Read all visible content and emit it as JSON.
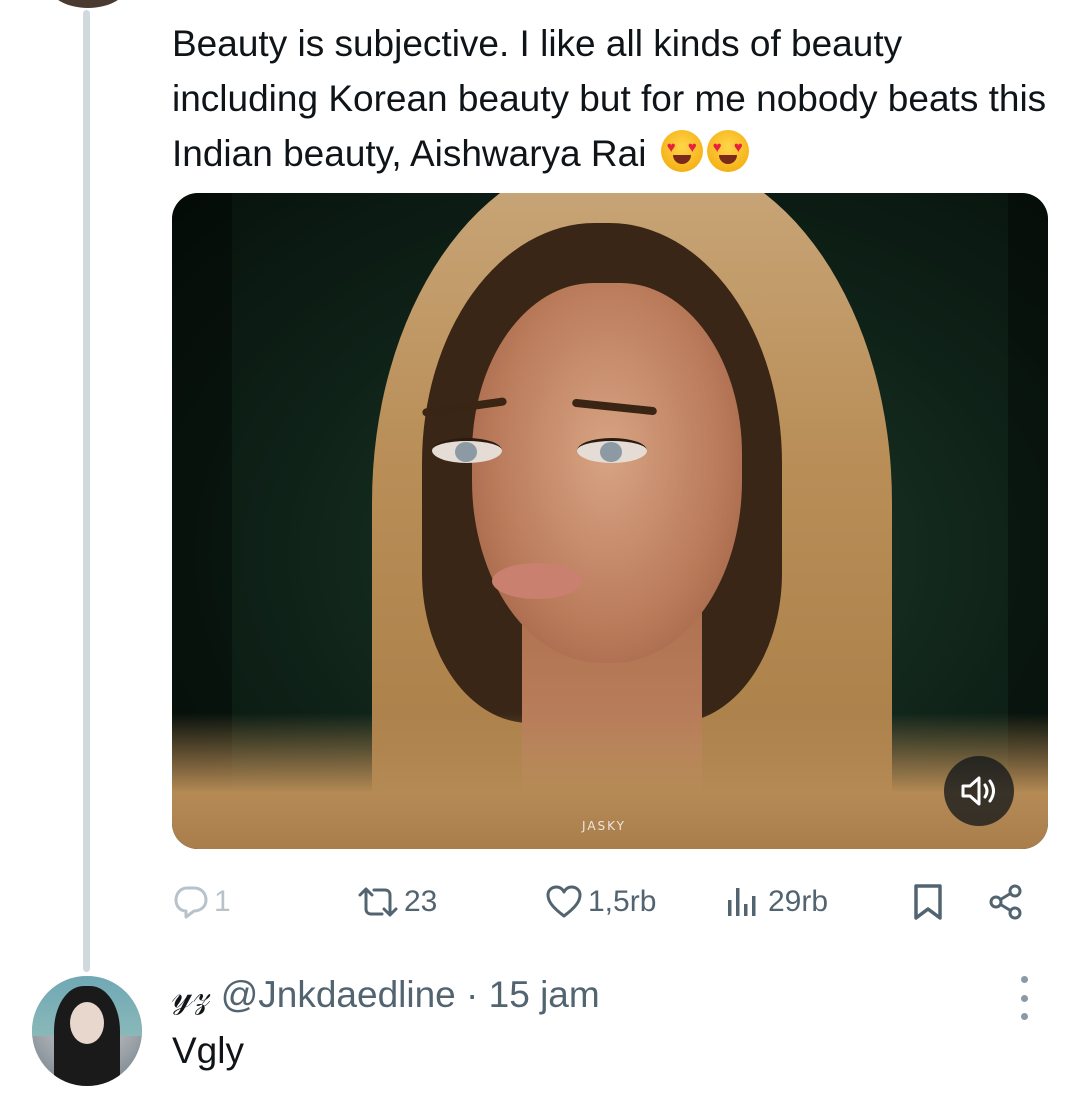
{
  "tweet": {
    "text": "Beauty is subjective. I like all kinds of beauty including Korean beauty but for me nobody beats this Indian beauty, Aishwarya Rai",
    "emojis": [
      "smiling-face-with-heart-eyes",
      "smiling-face-with-heart-eyes"
    ],
    "media": {
      "watermark": "JASKY",
      "sound_icon": "speaker-icon"
    },
    "actions": {
      "reply_count": "1",
      "retweet_count": "23",
      "like_count": "1,5rb",
      "views_count": "29rb"
    }
  },
  "reply": {
    "display_glyph": "𝓎𝓏",
    "handle": "@Jnkdaedline",
    "separator": "·",
    "time": "15 jam",
    "text": "Vgly"
  },
  "colors": {
    "text_primary": "#0f1419",
    "text_secondary": "#536471",
    "thread_line": "#cfd9de"
  }
}
